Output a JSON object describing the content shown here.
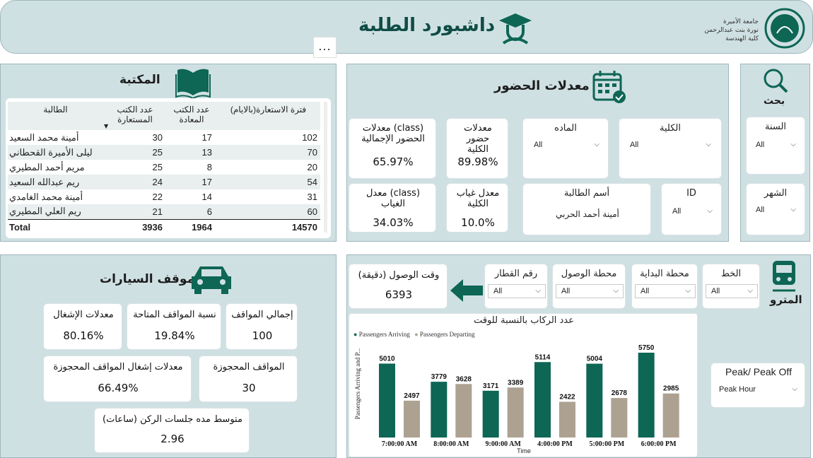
{
  "header": {
    "title": "داشبورد الطلبة",
    "logo_lines": [
      "جامعة الأميرة",
      "نورة بنت عبدالرحمن",
      "كلية الهندسة"
    ],
    "more_label": "..."
  },
  "library": {
    "title": "المكتبة",
    "columns": [
      "فترة الاستعارة(بالايام)",
      "عدد الكتب المعادة",
      "عدد الكتب المستعارة",
      "الطالبة"
    ],
    "rows": [
      {
        "period": "102",
        "returned": "17",
        "borrowed": "30",
        "student": "أمينة محمد السعيد"
      },
      {
        "period": "70",
        "returned": "13",
        "borrowed": "25",
        "student": "ليلى الأميرة القحطاني"
      },
      {
        "period": "20",
        "returned": "8",
        "borrowed": "25",
        "student": "مريم أحمد المطيري"
      },
      {
        "period": "54",
        "returned": "17",
        "borrowed": "24",
        "student": "ريم عبدالله السعيد"
      },
      {
        "period": "31",
        "returned": "14",
        "borrowed": "22",
        "student": "أمينة محمد الغامدي"
      },
      {
        "period": "60",
        "returned": "6",
        "borrowed": "21",
        "student": "ريم العلي المطيري"
      }
    ],
    "total": {
      "label": "Total",
      "period": "14570",
      "returned": "1964",
      "borrowed": "3936"
    }
  },
  "attendance": {
    "title": "معدلات الحضور",
    "class_total_label": "معدلات (class) الحضور الإجمالية",
    "class_total_value": "65.97%",
    "college_att_label": "معدلات حضور الكلية",
    "college_att_value": "89.98%",
    "class_absence_label": "معدل (class) الغياب",
    "class_absence_value": "34.03%",
    "college_absence_label": "معدل غياب الكلية",
    "college_absence_value": "10.0%",
    "subject_label": "الماده",
    "subject_value": "All",
    "college_label": "الكلية",
    "college_value": "All",
    "student_label": "أسم الطالبة",
    "student_value": "أمينة أحمد الحربي",
    "id_label": "ID",
    "id_value": "All"
  },
  "search": {
    "title": "بحث",
    "year_label": "السنة",
    "year_value": "All",
    "month_label": "الشهر",
    "month_value": "All"
  },
  "parking": {
    "title": "موقف السيارات",
    "occupancy_label": "معدلات الإشغال",
    "occupancy_value": "80.16%",
    "available_label": "نسبة المواقف المتاحة",
    "available_value": "19.84%",
    "total_label": "إجمالي المواقف",
    "total_value": "100",
    "reserved_occ_label": "معدلات إشغال المواقف المحجوزة",
    "reserved_occ_value": "66.49%",
    "reserved_label": "المواقف المحجوزة",
    "reserved_value": "30",
    "avg_session_label": "متوسط مده جلسات الركن (ساعات)",
    "avg_session_value": "2.96"
  },
  "metro": {
    "title": "المترو",
    "arrival_label": "وقت الوصول (دقيقة)",
    "arrival_value": "6393",
    "train_label": "رقم القطار",
    "train_value": "All",
    "arrival_station_label": "محطة الوصول",
    "arrival_station_value": "All",
    "start_station_label": "محطة البداية",
    "start_station_value": "All",
    "line_label": "الخط",
    "line_value": "All",
    "peak_label": "Peak/ Peak Off",
    "peak_value": "Peak Hour"
  },
  "chart_data": {
    "type": "bar",
    "title": "عدد الركاب بالنسبة للوقت",
    "xlabel": "Time",
    "ylabel": "Passengers Arriving and P...",
    "categories": [
      "7:00:00 AM",
      "8:00:00 AM",
      "9:00:00 AM",
      "4:00:00 PM",
      "5:00:00 PM",
      "6:00:00 PM"
    ],
    "series": [
      {
        "name": "Passengers Arriving",
        "color": "#0e6655",
        "values": [
          5010,
          3779,
          3171,
          5114,
          5004,
          5750
        ]
      },
      {
        "name": "Passengers Departing",
        "color": "#ada292",
        "values": [
          2497,
          3628,
          3389,
          2422,
          2678,
          2985
        ]
      }
    ],
    "ylim": [
      0,
      5750
    ],
    "legend": "top-left"
  }
}
